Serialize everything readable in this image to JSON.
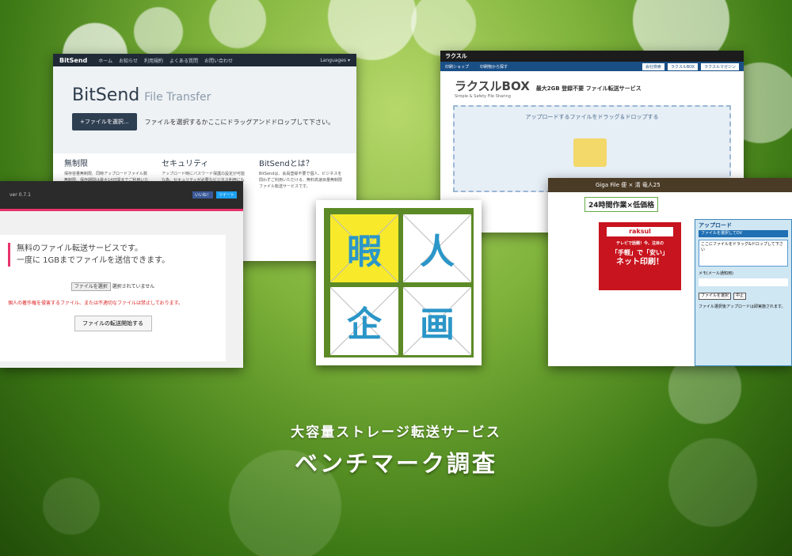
{
  "bitsend": {
    "brand": "BitSend",
    "nav": [
      "ホーム",
      "お知らせ",
      "利用規約",
      "よくある質問",
      "お問い合わせ"
    ],
    "languages": "Languages ▾",
    "title": "BitSend",
    "title_sub": "File Transfer",
    "select_button": "+ファイルを選択...",
    "drop_text": "ファイルを選択するかここにドラッグアンドドロップして下さい。",
    "features": [
      {
        "heading": "無制限",
        "text": "保存容量無制限、同時アップロードファイル数無制限、保存期間は最大14日間までご利用いただけます。"
      },
      {
        "heading": "セキュリティ",
        "text": "アップロード時にパスワード保護の設定が可能な為、セキュリティが必要なビジネス利用にもおすすめです。"
      },
      {
        "heading": "BitSendとは？",
        "text": "BitSendは、会員登録不要で個人、ビジネスを問わずご利用いただける、無料高速目量無制限ファイル転送サービスです。"
      }
    ]
  },
  "raksul": {
    "brand": "ラクスル",
    "menu": [
      "印刷ショップ",
      "印刷物から探す"
    ],
    "menu_right": [
      "会社検索",
      "ラクスルBOX",
      "ラクスルマガジン"
    ],
    "box_logo": "ラクスルBOX",
    "tagline": "Simple & Safety File Sharing",
    "headline": "最大2GB 登録不要 ファイル転送サービス",
    "drop_text": "アップロードするファイルをドラッグ＆ドロップする"
  },
  "hikari": {
    "version": "ver 0.7.1",
    "share": [
      "いいね！",
      "ツイート"
    ],
    "message_line1": "無料のファイル転送サービスです。",
    "message_line2": "一度に 1GBまでファイルを送信できます。",
    "file_button": "ファイルを選択",
    "file_status": "選択されていません",
    "warning": "個人の著作権を侵害するファイル、または不適切なファイルは禁止しております。",
    "send_button": "ファイルの転送開始する"
  },
  "giga": {
    "header": "Giga File 便 × 清 竜人25",
    "badge": "24時間作業×低価格",
    "ad_line1": "テレビで話題！今、注目の",
    "ad_line2": "「手軽」で「安い」",
    "ad_line3": "ネット印刷！",
    "ad_brand": "raksul",
    "panel_title": "アップロード",
    "panel_select": "ファイルを選択してDV",
    "panel_drop": "ここにファイルをドラッグ&ドロップして下さい",
    "panel_mail": "メモ(メール通知用)",
    "panel_btns": [
      "ファイルを選択",
      "中止"
    ],
    "panel_footer": "ファイル選択後アップロードは即実施されます。"
  },
  "logo": {
    "chars": [
      "暇",
      "人",
      "企",
      "画"
    ]
  },
  "caption": {
    "line1": "大容量ストレージ転送サービス",
    "line2": "ベンチマーク調査"
  }
}
